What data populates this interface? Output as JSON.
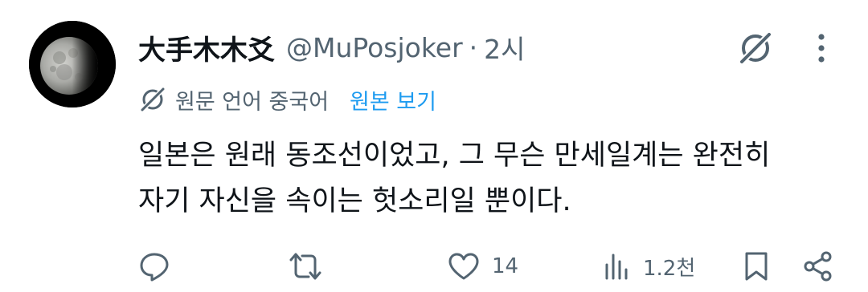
{
  "tweet": {
    "display_name": "大手木木爻",
    "handle": "@MuPosjoker",
    "separator": "·",
    "time": "2시",
    "translate": {
      "label": "원문 언어 중국어",
      "link": "원본 보기"
    },
    "body_lines": [
      "일본은 원래 동조선이었고, 그 무슨 만세일계는 완전히",
      "자기 자신을 속이는 헛소리일 뿐이다."
    ],
    "actions": {
      "likes": "14",
      "views": "1.2천"
    }
  },
  "icons": {
    "grok": "grok-icon",
    "more": "more-dots-icon",
    "reply": "reply-icon",
    "retweet": "retweet-icon",
    "like": "heart-icon",
    "views": "views-bar-chart-icon",
    "bookmark": "bookmark-icon",
    "share": "share-icon"
  },
  "colors": {
    "text": "#0f1419",
    "secondary": "#536471",
    "link": "#1d9bf0"
  }
}
